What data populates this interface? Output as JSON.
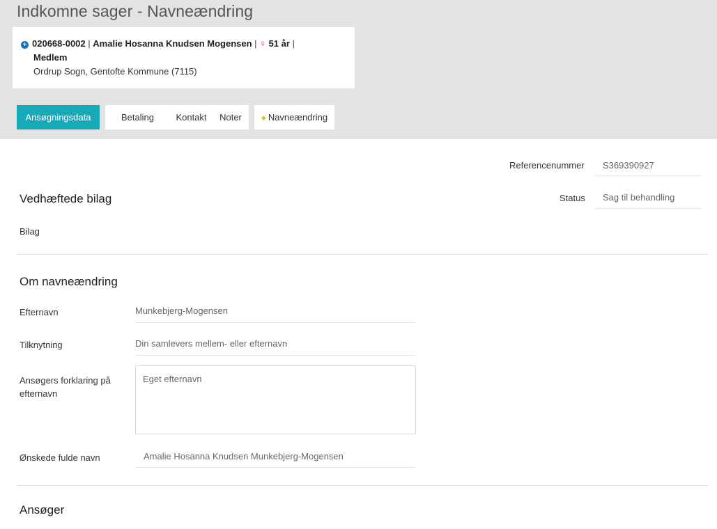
{
  "title": "Indkomne sager - Navneændring",
  "person": {
    "id": "020668-0002",
    "name": "Amalie Hosanna Knudsen Mogensen",
    "age": "51 år",
    "membership": "Medlem",
    "location": "Ordrup Sogn, Gentofte Kommune (7115)",
    "separator": "|",
    "icons": {
      "expand": "plus-circle-icon",
      "gender": "female-icon"
    },
    "colors": {
      "expand_icon": "#1b6fb5",
      "gender_icon": "#d23f2b"
    }
  },
  "tabs": [
    {
      "label": "Ansøgningsdata",
      "active": true
    },
    {
      "label": "Betaling",
      "active": false
    },
    {
      "label": "Kontakt",
      "active": false
    },
    {
      "label": "Noter",
      "active": false
    },
    {
      "label": "Navneændring",
      "active": false,
      "icon": "diamond-icon"
    }
  ],
  "colors": {
    "active_tab": "#17a9b8",
    "header_bg": "#e3e3e3",
    "diamond": "#d4c531"
  },
  "meta": {
    "reference_label": "Referencenummer",
    "reference_value": "S369390927",
    "status_label": "Status",
    "status_value": "Sag til behandling"
  },
  "attachments": {
    "title": "Vedhæftede bilag",
    "bilag_label": "Bilag"
  },
  "name_change": {
    "title": "Om navneændring",
    "surname_label": "Efternavn",
    "surname_value": "Munkebjerg-Mogensen",
    "relation_label": "Tilknytning",
    "relation_value": "Din samlevers mellem- eller efternavn",
    "explanation_label": "Ansøgers forklaring på efternavn",
    "explanation_value": "Eget efternavn",
    "fullname_label": "Ønskede fulde navn",
    "fullname_value": "Amalie Hosanna Knudsen Munkebjerg-Mogensen"
  },
  "applicant": {
    "title": "Ansøger"
  }
}
